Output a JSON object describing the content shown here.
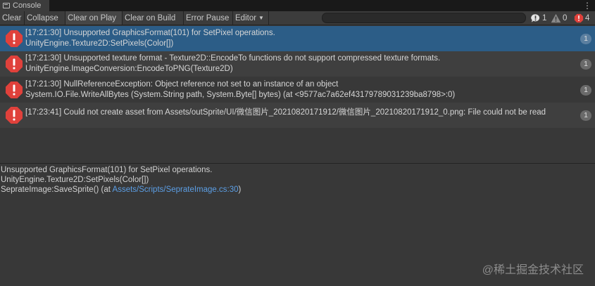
{
  "tab": {
    "title": "Console"
  },
  "toolbar": {
    "clear": "Clear",
    "collapse": "Collapse",
    "clear_on_play": "Clear on Play",
    "clear_on_build": "Clear on Build",
    "error_pause": "Error Pause",
    "editor": "Editor",
    "search_value": "",
    "counts": {
      "info": "1",
      "warning": "0",
      "error": "4"
    }
  },
  "entries": [
    {
      "line1": "[17:21:30] Unsupported GraphicsFormat(101) for SetPixel operations.",
      "line2": "UnityEngine.Texture2D:SetPixels(Color[])",
      "count": "1",
      "selected": true
    },
    {
      "line1": "[17:21:30] Unsupported texture format - Texture2D::EncodeTo functions do not support compressed texture formats.",
      "line2": "UnityEngine.ImageConversion:EncodeToPNG(Texture2D)",
      "count": "1"
    },
    {
      "line1": "[17:21:30] NullReferenceException: Object reference not set to an instance of an object",
      "line2": "System.IO.File.WriteAllBytes (System.String path, System.Byte[] bytes) (at <9577ac7a62ef43179789031239ba8798>:0)",
      "count": "1"
    },
    {
      "line1": "[17:23:41] Could not create asset from Assets/outSprite/UI/微信图片_20210820171912/微信图片_20210820171912_0.png: File could not be read",
      "line2": "",
      "count": "1"
    }
  ],
  "detail": {
    "line1": "Unsupported GraphicsFormat(101) for SetPixel operations.",
    "line2": "UnityEngine.Texture2D:SetPixels(Color[])",
    "line3_prefix": "SeprateImage:SaveSprite() (at ",
    "line3_link": "Assets/Scripts/SeprateImage.cs:30",
    "line3_suffix": ")"
  },
  "watermark": "@稀土掘金技术社区",
  "colors": {
    "selected_row": "#2c5d87",
    "error_icon": "#e0413b",
    "link": "#5c9fe6"
  },
  "icons": {
    "tab": "console-icon",
    "row": "error-icon",
    "search": "search-icon",
    "menu": "kebab-menu-icon"
  }
}
